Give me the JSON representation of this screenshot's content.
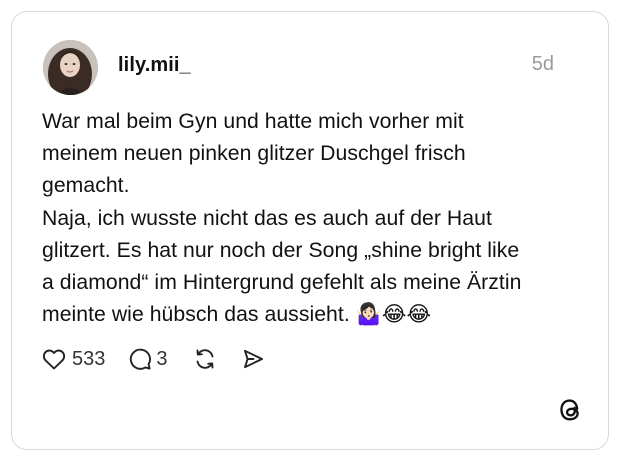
{
  "post": {
    "username": "lily.mii_",
    "time": "5d",
    "text_lines": [
      "War mal beim Gyn und hatte mich vorher mit",
      "meinem neuen pinken glitzer Duschgel frisch",
      "gemacht.",
      "Naja, ich wusste nicht das es auch auf der Haut",
      "glitzert. Es hat nur noch der Song „shine bright like",
      "a diamond“ im Hintergrund gefehlt als meine Ärztin",
      "meinte wie hübsch das aussieht."
    ],
    "emojis": "🤷🏻‍♀️😂😂",
    "likes": "533",
    "replies": "3"
  },
  "icons": {
    "avatar": "profile-photo",
    "like": "heart-icon",
    "reply": "comment-icon",
    "repost": "repost-icon",
    "share": "send-icon",
    "brand": "threads-logo-icon"
  },
  "colors": {
    "text": "#111111",
    "muted": "#9a9a9a",
    "border": "#d9d9d9",
    "background": "#ffffff"
  }
}
